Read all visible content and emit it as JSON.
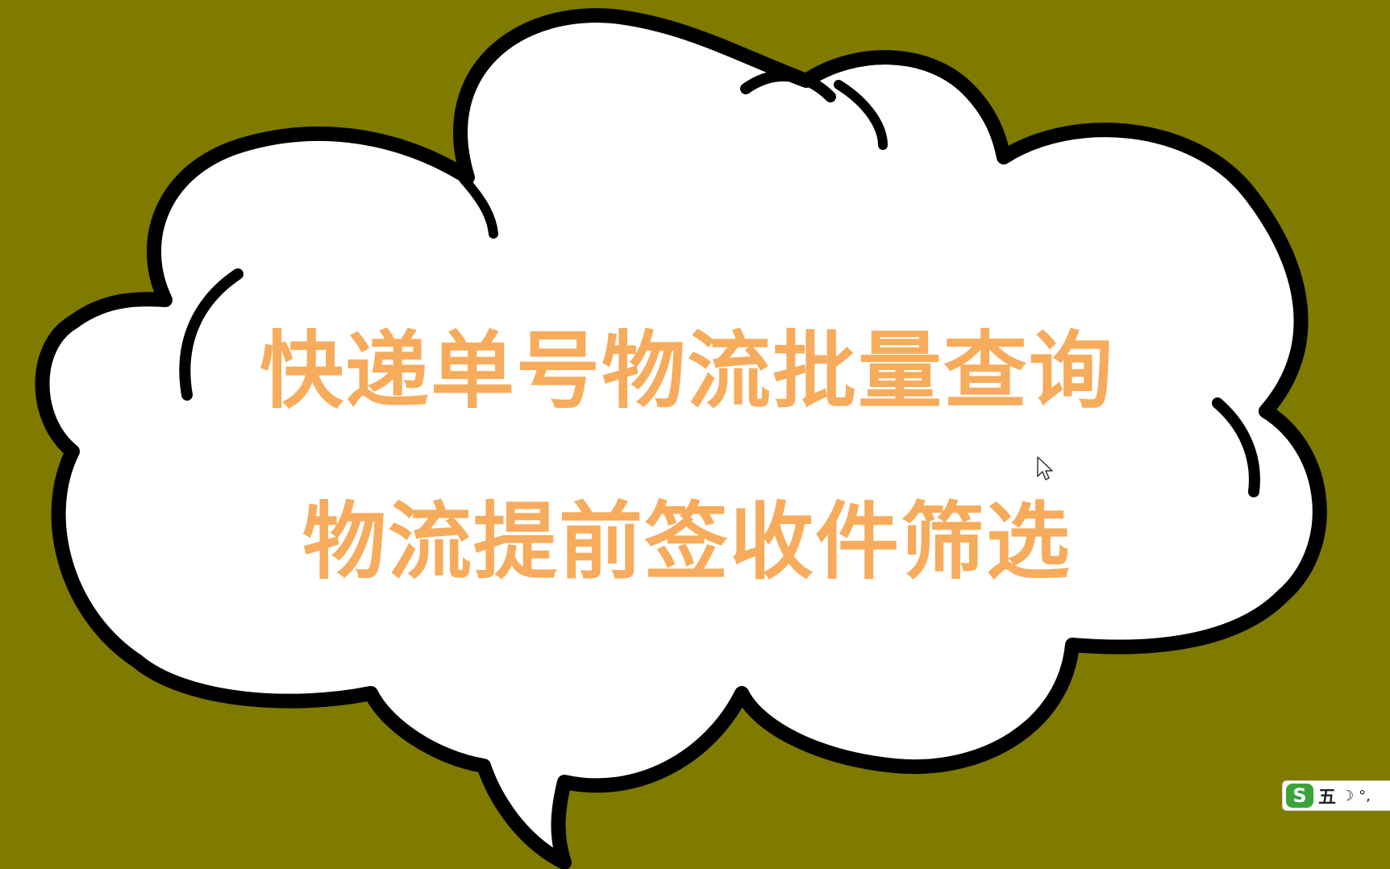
{
  "title_lines": {
    "line1": "快递单号物流批量查询",
    "line2": "物流提前签收件筛选"
  },
  "ime_toolbar": {
    "logo": "S",
    "mode": "五",
    "moon": "☽",
    "punct": "°,"
  },
  "colors": {
    "background": "#7f7a00",
    "cloud_fill": "#ffffff",
    "cloud_outline": "#000000",
    "title_text": "#f6ac5c",
    "ime_logo": "#3aa33a"
  },
  "icons": {
    "cursor": "mouse-pointer-icon",
    "ime_logo": "sogou-ime-logo-icon",
    "moon": "half-width-moon-icon"
  }
}
